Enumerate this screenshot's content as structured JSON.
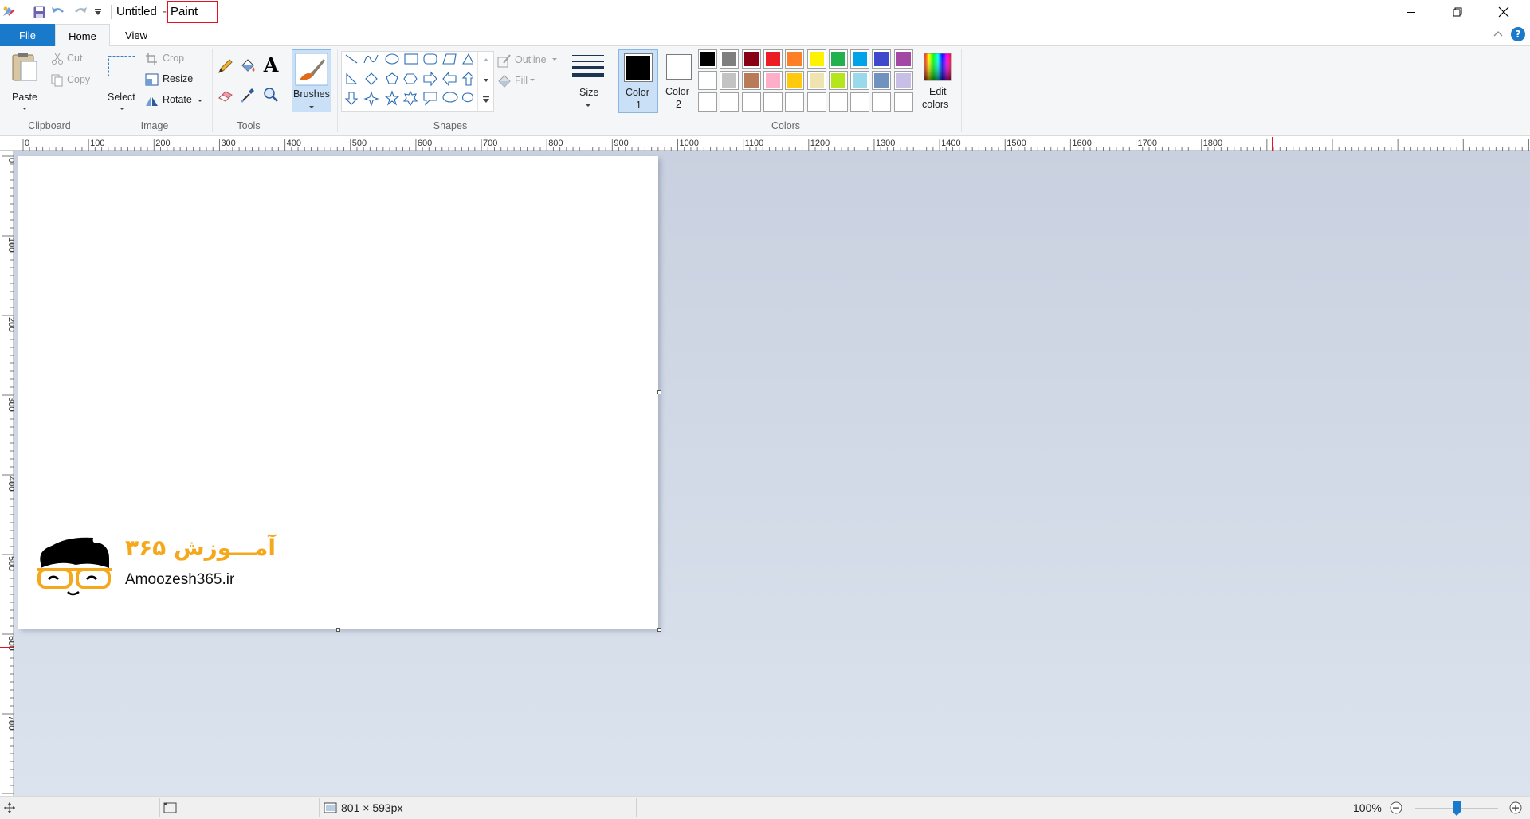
{
  "window": {
    "document_name": "Untitled",
    "separator": "-",
    "app_name": "Paint",
    "controls": [
      "minimize-icon",
      "restore-icon",
      "close-icon"
    ]
  },
  "quick_access": [
    "save-icon",
    "undo-icon",
    "redo-icon",
    "customize-chevron-icon"
  ],
  "tabs": [
    {
      "label": "File",
      "active": false
    },
    {
      "label": "Home",
      "active": true
    },
    {
      "label": "View",
      "active": false
    }
  ],
  "ribbon": {
    "clipboard": {
      "group": "Clipboard",
      "paste": "Paste",
      "cut": "Cut",
      "copy": "Copy"
    },
    "image": {
      "group": "Image",
      "select": "Select",
      "crop": "Crop",
      "resize": "Resize",
      "rotate": "Rotate"
    },
    "tools": {
      "group": "Tools",
      "items": [
        "pencil-icon",
        "fill-bucket-icon",
        "text-icon",
        "eraser-icon",
        "color-picker-icon",
        "magnifier-icon"
      ],
      "text_glyph": "A"
    },
    "brushes": {
      "label": "Brushes"
    },
    "shapes": {
      "group": "Shapes",
      "outline": "Outline",
      "fill": "Fill"
    },
    "size": {
      "label": "Size"
    },
    "colors": {
      "group": "Colors",
      "color1": {
        "label": "Color",
        "num": "1",
        "value": "#000000"
      },
      "color2": {
        "label": "Color",
        "num": "2",
        "value": "#ffffff"
      },
      "edit": {
        "line1": "Edit",
        "line2": "colors"
      },
      "palette_row1": [
        "#000000",
        "#7f7f7f",
        "#880015",
        "#ed1c24",
        "#ff7f27",
        "#fff200",
        "#22b14c",
        "#00a2e8",
        "#3f48cc",
        "#a349a4"
      ],
      "palette_row2": [
        "#ffffff",
        "#c3c3c3",
        "#b97a57",
        "#ffaec9",
        "#ffc90e",
        "#efe4b0",
        "#b5e61d",
        "#99d9ea",
        "#7092be",
        "#c8bfe7"
      ]
    }
  },
  "rulers": {
    "horizontal": [
      "0",
      "100",
      "200",
      "300",
      "400",
      "500",
      "600",
      "700",
      "800",
      "900",
      "1000",
      "1100",
      "1200",
      "1300",
      "1400",
      "1500",
      "1600",
      "1700",
      "1800"
    ],
    "vertical": [
      "0",
      "100",
      "200",
      "300",
      "400",
      "500",
      "600",
      "700"
    ]
  },
  "canvas": {
    "logo": {
      "site": "Amoozesh365.ir",
      "persian": "آمـــوزش ۳۶۵"
    }
  },
  "status": {
    "image_size": "801 × 593px",
    "zoom": "100%",
    "zoom_level_percent": 100
  },
  "colors": {
    "accent": "#1979ca",
    "highlight_box": "#e81123",
    "logo_orange": "#f5a81b"
  }
}
